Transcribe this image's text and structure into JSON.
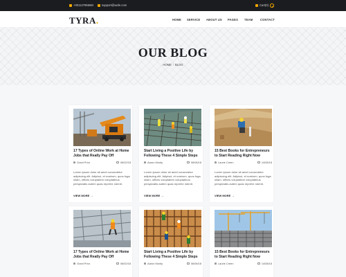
{
  "topbar": {
    "phone": "+00112785668I",
    "email": "support@wafe.com",
    "cart": "Cart(0)"
  },
  "brand": {
    "logo_text": "TYRA",
    "logo_dot": "."
  },
  "menu": [
    "HOME",
    "SERVICE",
    "ABOUT US",
    "PAGES",
    "TEAM",
    "CONTACT"
  ],
  "hero": {
    "title": "OUR BLOG",
    "breadcrumb": [
      "HOME",
      "BLOG"
    ],
    "breadcrumb_separator": "/"
  },
  "read_more_label": "VIEW MORE →",
  "cards": [
    {
      "title": "17 Types of Online Work at Home Jobs that Really Pay Off",
      "author": "Grant Prior",
      "date": "06/02/18",
      "excerpt": "Lorem ipsum dolor sit amet consectetur adipiscing elit. Adipisci, et nostrum, quos fuga ullam, officiis voluptatem voluptatibus perspiciatis autem quas reprehe ndenit.",
      "image": "crane-excavator"
    },
    {
      "title": "Start Living a Positive Life by Following These 4 Simple Steps",
      "author": "Aaron Monty",
      "date": "06/06/18",
      "excerpt": "Lorem ipsum dolor sit amet consectetur adipiscing elit. Adipisci, et nostrum, quos fuga ullam, officiis voluptatem voluptatibus perspiciatis autem quas reprehe ndenit.",
      "image": "rebar-workers"
    },
    {
      "title": "15 Best Books for Entrepreneurs to Start Reading Right Now",
      "author": "Laurie Creen",
      "date": "14/08/18",
      "excerpt": "Lorem ipsum dolor sit amet consectetur adipiscing elit. Adipisci, et nostrum, quos fuga ullam, officiis voluptatem voluptatibus perspiciatis autem quas reprehe ndenit.",
      "image": "worker-sand"
    },
    {
      "title": "17 Types of Online Work at Home Jobs that Really Pay Off",
      "author": "Grant Prior",
      "date": "06/02/18",
      "excerpt": "",
      "image": "scaffold-worker"
    },
    {
      "title": "Start Living a Positive Life by Following These 4 Simple Steps",
      "author": "Aaron Monty",
      "date": "06/06/18",
      "excerpt": "",
      "image": "steel-frame-workers"
    },
    {
      "title": "15 Best Books for Entrepreneurs to Start Reading Right Now",
      "author": "Laurie Creen",
      "date": "14/08/18",
      "excerpt": "",
      "image": "crane-building"
    }
  ],
  "colors": {
    "accent": "#f2a900",
    "dark": "#1b1c20",
    "page_bg": "#f6f7f9"
  }
}
